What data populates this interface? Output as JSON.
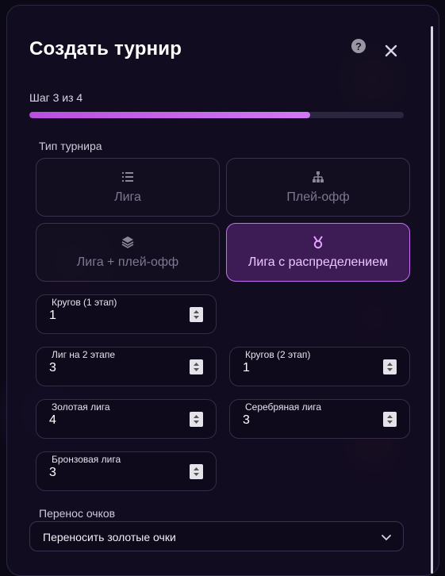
{
  "modal": {
    "title": "Создать турнир",
    "help_symbol": "?",
    "step_text": "Шаг 3 из 4",
    "progress": 0.75
  },
  "tournament_type": {
    "label": "Тип турнира",
    "options": [
      {
        "label": "Лига",
        "icon": "list-icon",
        "selected": false
      },
      {
        "label": "Плей-офф",
        "icon": "bracket-icon",
        "selected": false
      },
      {
        "label": "Лига + плей-офф",
        "icon": "layers-icon",
        "selected": false
      },
      {
        "label": "Лига с распределением",
        "icon": "medal-icon",
        "selected": true
      }
    ]
  },
  "fields": {
    "rounds_stage1": {
      "label": "Кругов (1 этап)",
      "value": "1"
    },
    "leagues_stage2": {
      "label": "Лиг на 2 этапе",
      "value": "3"
    },
    "rounds_stage2": {
      "label": "Кругов (2 этап)",
      "value": "1"
    },
    "gold_league": {
      "label": "Золотая лига",
      "value": "4"
    },
    "silver_league": {
      "label": "Серебряная лига",
      "value": "3"
    },
    "bronze_league": {
      "label": "Бронзовая лига",
      "value": "3"
    }
  },
  "points_transfer": {
    "label": "Перенос очков",
    "selected": "Переносить золотые очки"
  },
  "colors": {
    "accent": "#c56ef0",
    "progress_fill": "#c665ec",
    "background": "#0c0917"
  }
}
